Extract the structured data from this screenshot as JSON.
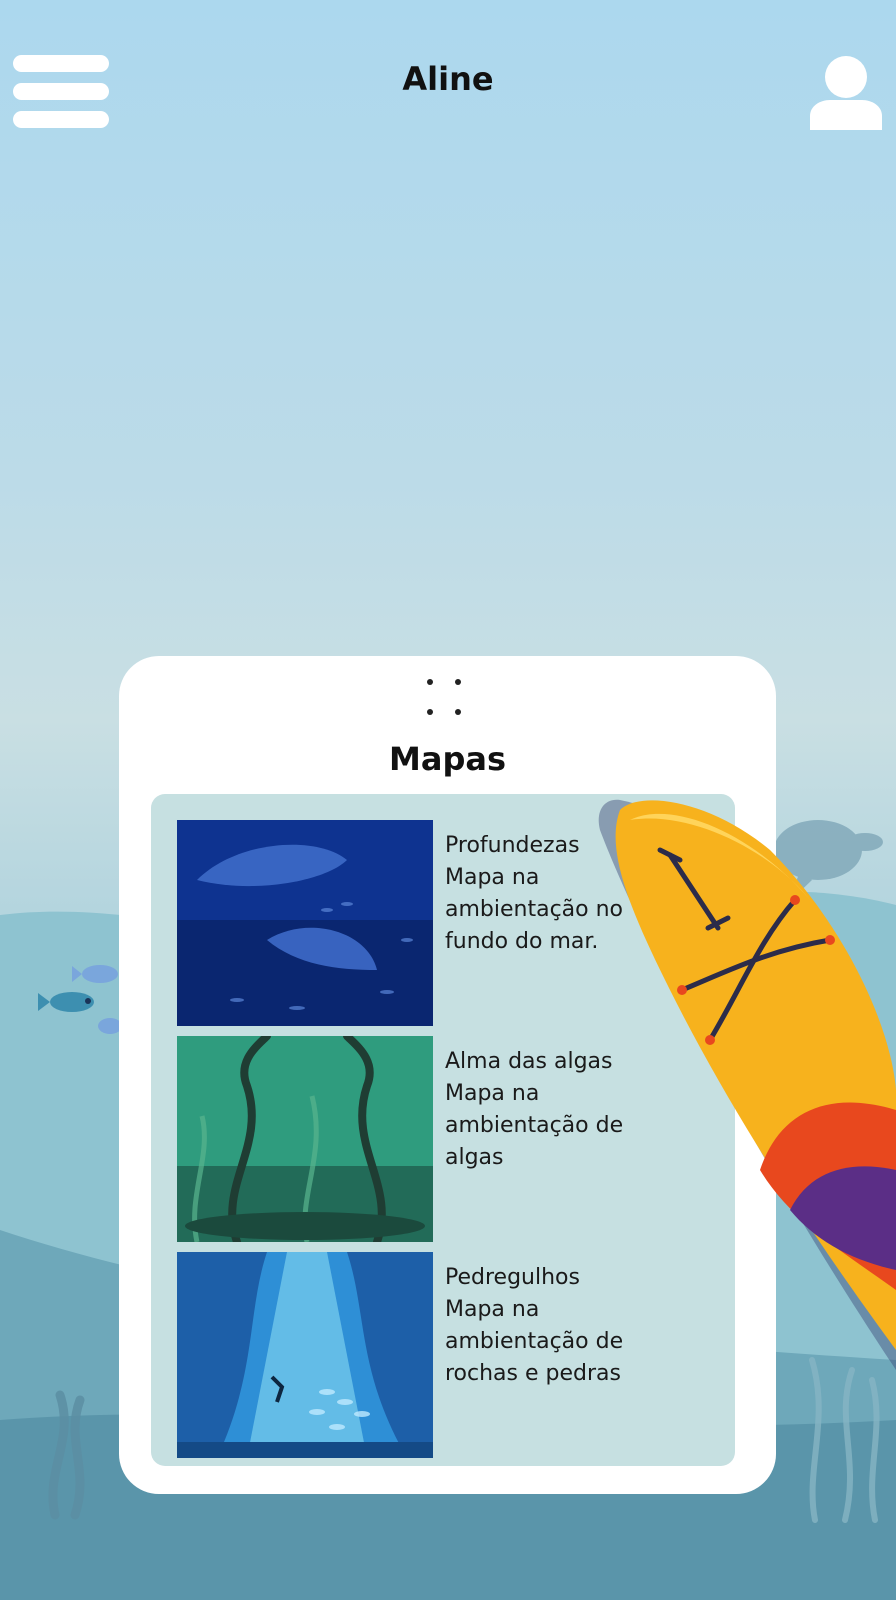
{
  "header": {
    "title": "Aline",
    "menu_icon": "hamburger-menu-icon",
    "profile_icon": "user-profile-icon"
  },
  "maps_card": {
    "title": "Mapas",
    "handle_icon": "drag-handle-icon",
    "items": [
      {
        "name": "Profundezas",
        "desc_line1": "Mapa na",
        "desc_line2": "ambientação no",
        "desc_line3": "fundo do mar.",
        "thumbnail": "deep-sea-whale-sharks"
      },
      {
        "name": "Alma das algas",
        "desc_line1": "Mapa na",
        "desc_line2": "ambientação de",
        "desc_line3": "algas",
        "thumbnail": "kelp-forest"
      },
      {
        "name": "Pedregulhos",
        "desc_line1": "Mapa na",
        "desc_line2": "ambientação de",
        "desc_line3": "rochas e pedras",
        "thumbnail": "underwater-cave-diver"
      }
    ]
  },
  "colors": {
    "sky_top": "#acd8ee",
    "sea": "#6ba9bb",
    "card": "#ffffff",
    "panel": "#c6e0e1",
    "kayak": "#f7b21d"
  }
}
